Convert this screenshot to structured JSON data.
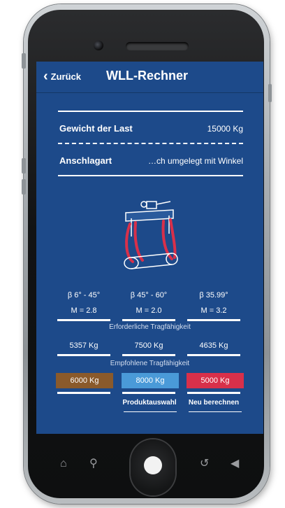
{
  "nav": {
    "back_icon": "‹",
    "back_label": "Zurück",
    "title": "WLL-Rechner"
  },
  "form": {
    "weight_label": "Gewicht der Last",
    "weight_value": "15000 Kg",
    "sling_label": "Anschlagart",
    "sling_value": "…ch umgelegt mit Winkel"
  },
  "angles": [
    {
      "beta": "β 6° - 45°",
      "m": "M = 2.8"
    },
    {
      "beta": "β 45° - 60°",
      "m": "M = 2.0"
    },
    {
      "beta": "β 35.99°",
      "m": "M = 3.2"
    }
  ],
  "required_caption": "Erforderliche Tragfähigkeit",
  "required_values": [
    "5357 Kg",
    "7500 Kg",
    "4635 Kg"
  ],
  "recommended_caption": "Empfohlene Tragfähigkeit",
  "recommended": [
    {
      "value": "6000 Kg",
      "color": "#8a5a2b"
    },
    {
      "value": "8000 Kg",
      "color": "#4a9ad8"
    },
    {
      "value": "5000 Kg",
      "color": "#d8304a"
    }
  ],
  "actions": {
    "product_selection": "Produktauswahl",
    "recalculate": "Neu berechnen"
  },
  "hardware_icons": [
    "home-icon",
    "search-icon",
    "back-icon",
    "volume-icon"
  ],
  "colors": {
    "screen_bg": "#1d4a8a",
    "sling": "#d8304a"
  }
}
